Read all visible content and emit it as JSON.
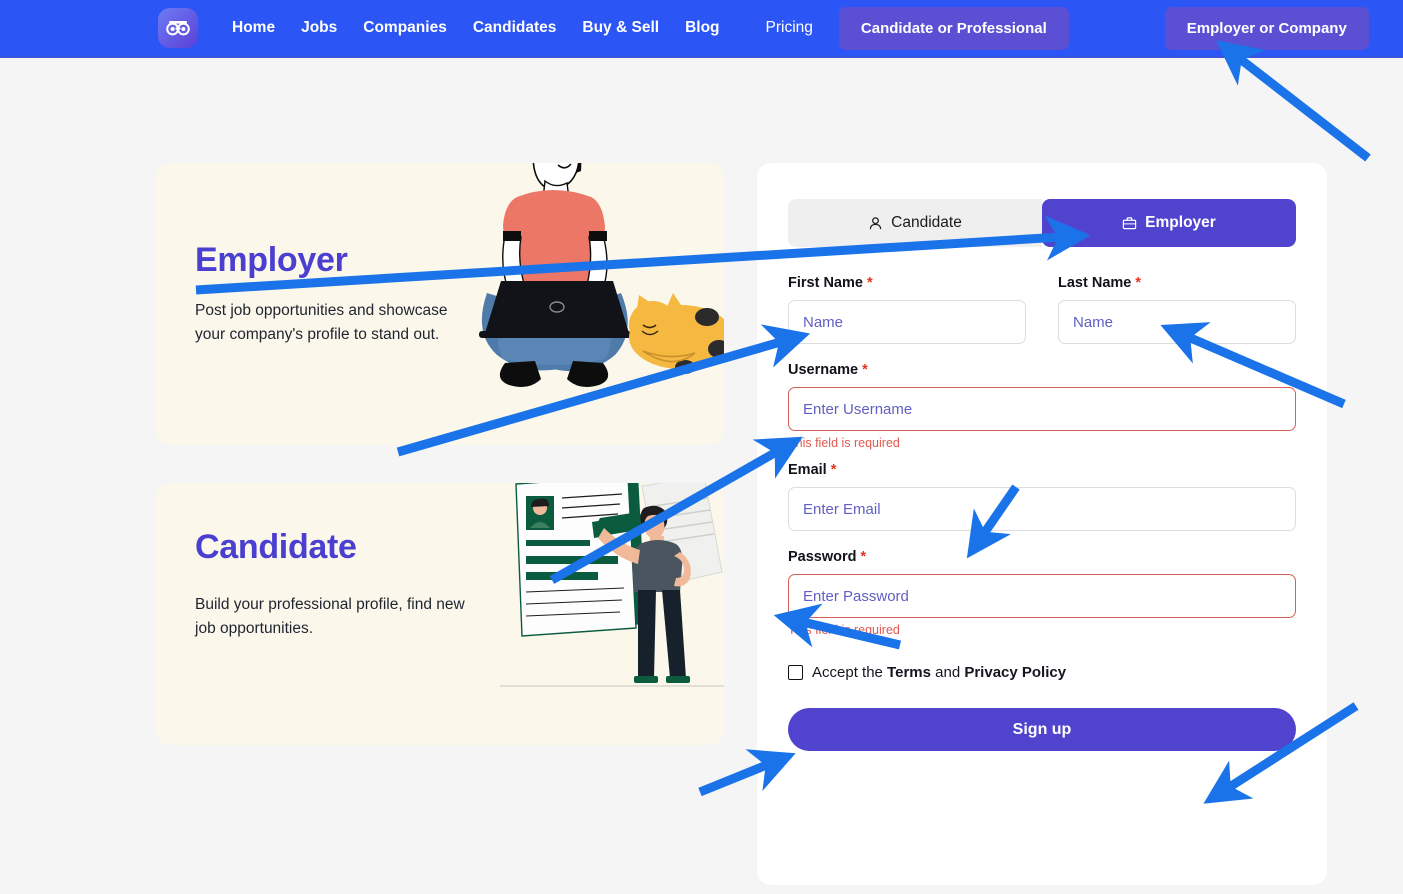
{
  "navbar": {
    "logo_icon": "binoculars-icon",
    "links": [
      {
        "label": "Home"
      },
      {
        "label": "Jobs"
      },
      {
        "label": "Companies"
      },
      {
        "label": "Candidates"
      },
      {
        "label": "Buy & Sell"
      },
      {
        "label": "Blog"
      },
      {
        "label": "Pricing"
      }
    ],
    "candidate_button": "Candidate or Professional",
    "employer_button": "Employer or Company",
    "background_color": "#2b55f5",
    "button_color": "#5b4fd4"
  },
  "promos": [
    {
      "title": "Employer",
      "text": "Post job opportunities and showcase your company's profile to stand out.",
      "illustration": "woman-with-laptop-and-cat",
      "title_color": "#4a3fd0",
      "card_color": "#fbf7ea"
    },
    {
      "title": "Candidate",
      "text": "Build your professional profile, find new job opportunities.",
      "illustration": "person-with-resume-document",
      "title_color": "#4a3fd0",
      "card_color": "#fbf7ea"
    }
  ],
  "form": {
    "tabs": [
      {
        "label": "Candidate",
        "icon": "user-icon",
        "active": false
      },
      {
        "label": "Employer",
        "icon": "briefcase-icon",
        "active": true
      }
    ],
    "accent_color": "#5044cf",
    "error_color": "#e0594f",
    "fields": {
      "first_name": {
        "label": "First Name",
        "required_marker": "*",
        "value": "",
        "placeholder": "Name",
        "error": ""
      },
      "last_name": {
        "label": "Last Name",
        "required_marker": "*",
        "value": "",
        "placeholder": "Name",
        "error": ""
      },
      "username": {
        "label": "Username",
        "required_marker": "*",
        "value": "",
        "placeholder": "Enter Username",
        "error": "This field is required"
      },
      "email": {
        "label": "Email",
        "required_marker": "*",
        "value": "",
        "placeholder": "Enter Email",
        "error": ""
      },
      "password": {
        "label": "Password",
        "required_marker": "*",
        "value": "",
        "placeholder": "Enter Password",
        "error": "This field is required"
      }
    },
    "terms": {
      "prefix": "Accept the ",
      "terms_link": "Terms",
      "middle": " and ",
      "privacy_link": "Privacy Policy",
      "checked": false
    },
    "submit_label": "Sign up"
  },
  "annotations": {
    "arrow_color": "#1a73e8",
    "arrows": [
      {
        "target": "employer-or-company-button"
      },
      {
        "target": "employer-tab"
      },
      {
        "target": "first-name-input"
      },
      {
        "target": "last-name-input"
      },
      {
        "target": "username-input"
      },
      {
        "target": "email-input"
      },
      {
        "target": "password-label"
      },
      {
        "target": "terms-checkbox"
      },
      {
        "target": "signup-button"
      }
    ]
  }
}
